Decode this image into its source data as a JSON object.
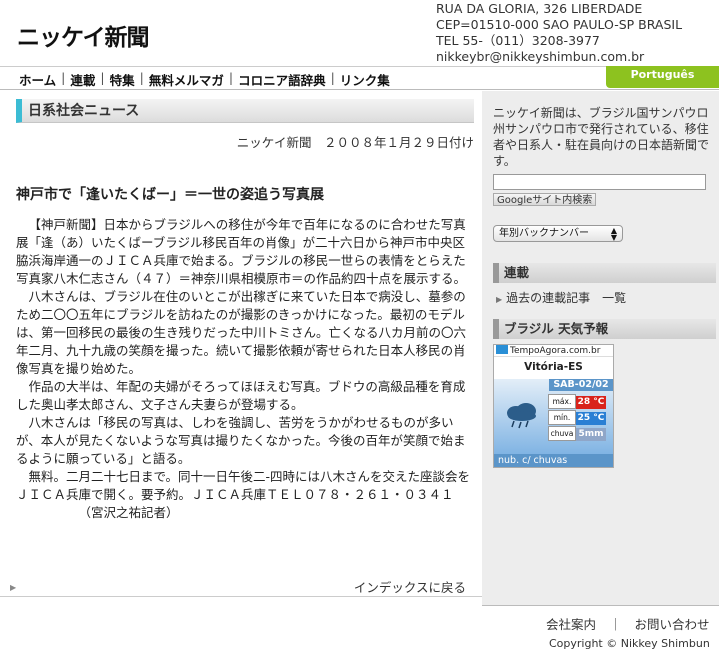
{
  "header": {
    "logo": "ニッケイ新聞",
    "address": [
      "RUA DA GLORIA, 326 LIBERDADE",
      "CEP=01510-000 SAO PAULO-SP BRASIL",
      "TEL 55-（011）3208-3977",
      "nikkeybr@nikkeyshimbun.com.br"
    ]
  },
  "nav": {
    "items": [
      "ホーム",
      "連載",
      "特集",
      "無料メルマガ",
      "コロニア語辞典",
      "リンク集"
    ],
    "language_tab": "Português"
  },
  "main": {
    "section_title": "日系社会ニュース",
    "dateline": "ニッケイ新聞　２００８年１月２９日付け",
    "article_title": "神戸市で「逢いたくばー」＝一世の姿追う写真展",
    "paragraphs": [
      "【神戸新聞】日本からブラジルへの移住が今年で百年になるのに合わせた写真展「逢（あ）いたくばーブラジル移民百年の肖像」が二十六日から神戸市中央区脇浜海岸通一のＪＩＣＡ兵庫で始まる。ブラジルの移民一世らの表情をとらえた写真家八木仁志さん（４７）＝神奈川県相模原市＝の作品約四十点を展示する。",
      "八木さんは、ブラジル在住のいとこが出稼ぎに来ていた日本で病没し、墓参のため二〇〇五年にブラジルを訪ねたのが撮影のきっかけになった。最初のモデルは、第一回移民の最後の生き残りだった中川トミさん。亡くなる八カ月前の〇六年二月、九十九歳の笑顔を撮った。続いて撮影依頼が寄せられた日本人移民の肖像写真を撮り始めた。",
      "作品の大半は、年配の夫婦がそろってほほえむ写真。ブドウの高級品種を育成した奥山孝太郎さん、文子さん夫妻らが登場する。",
      "八木さんは「移民の写真は、しわを強調し、苦労をうかがわせるものが多いが、本人が見たくないような写真は撮りたくなかった。今後の百年が笑顔で始まるように願っている」と語る。",
      "無料。二月二十七日まで。同十一日午後二-四時には八木さんを交えた座談会をＪＩＣＡ兵庫で開く。要予約。ＪＩＣＡ兵庫ＴＥＬ０７８・２６１・０３４１"
    ],
    "author": "（宮沢之祐記者）",
    "index_link": "インデックスに戻る"
  },
  "sidebar": {
    "description": "ニッケイ新聞は、ブラジル国サンパウロ州サンパウロ市で発行されている、移住者や日系人・駐在員向けの日本語新聞です。",
    "search_value": "",
    "search_button": "Googleサイト内検索",
    "back_numbers": "年別バックナンバー",
    "serial_head": "連載",
    "serial_link": "過去の連載記事　一覧",
    "weather_head": "ブラジル 天気予報",
    "weather": {
      "brand": "TempoAgora.com.br",
      "city": "Vitória-ES",
      "date": "SAB-02/02",
      "max_label": "máx.",
      "max_value": "28 °C",
      "min_label": "mín.",
      "min_value": "25 °C",
      "rain_label": "chuva",
      "rain_value": "5mm",
      "condition": "nub. c/ chuvas",
      "colors": {
        "panel": "#5b95c9",
        "max": "#d9231c",
        "min": "#2a7fd4",
        "rain": "#8fa6c8"
      }
    }
  },
  "footer": {
    "company_link": "会社案内",
    "contact_link": "お問い合わせ",
    "separator": "｜",
    "copyright": "Copyright © Nikkey Shimbun"
  }
}
